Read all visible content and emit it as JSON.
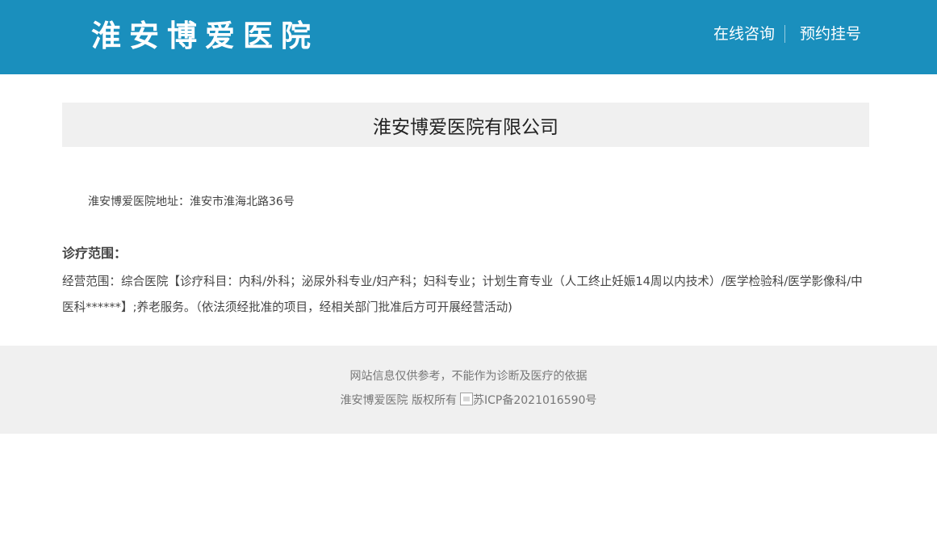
{
  "header": {
    "logo_text": "淮安博爱医院",
    "nav": {
      "consult_label": "在线咨询",
      "appointment_label": "预约挂号"
    }
  },
  "main": {
    "title": "淮安博爱医院有限公司",
    "address": "淮安博爱医院地址：淮安市淮海北路36号",
    "scope_heading": "诊疗范围：",
    "scope_text": "经营范围：综合医院【诊疗科目：内科/外科；泌尿外科专业/妇产科；妇科专业；计划生育专业（人工终止妊娠14周以内技术）/医学检验科/医学影像科/中医科******】;养老服务。（依法须经批准的项目，经相关部门批准后方可开展经营活动)"
  },
  "footer": {
    "disclaimer": "网站信息仅供参考，不能作为诊断及医疗的依据",
    "copyright": "淮安博爱医院 版权所有",
    "icp_alt": "苏ICP备2021016590号"
  },
  "colors": {
    "header_bg": "#1a8fbd",
    "title_box_bg": "#f0f0f0",
    "footer_bg": "#f0f0f0"
  }
}
